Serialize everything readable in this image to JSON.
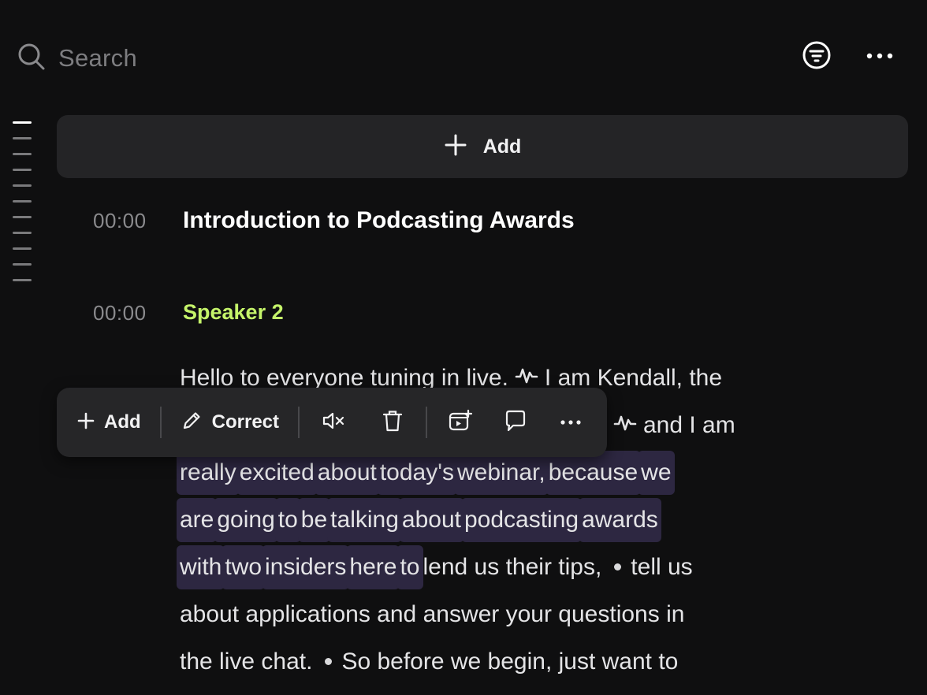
{
  "search": {
    "placeholder": "Search",
    "icon": "search-icon"
  },
  "header_actions": {
    "filter_icon": "filter-icon",
    "more_icon": "more-icon"
  },
  "add_section": {
    "label": "Add"
  },
  "chapter": {
    "timestamp": "00:00",
    "title": "Introduction to Podcasting Awards"
  },
  "paragraph": {
    "timestamp": "00:00",
    "speaker": "Speaker 2"
  },
  "transcript": {
    "line1_a": "Hello to everyone tuning in live.",
    "line1_b": "I am Kendall, the",
    "line2_tail": "and I am",
    "line3": [
      "really",
      "excited",
      "about",
      "today's",
      "webinar,",
      "because",
      "we"
    ],
    "line4": [
      "are",
      "going",
      "to",
      "be",
      "talking",
      "about",
      "podcasting",
      "awards"
    ],
    "line5_hl": [
      "with",
      "two",
      "insiders",
      "here",
      "to"
    ],
    "line5_tail_a": "lend us their tips,",
    "line5_tail_b": "tell us",
    "line6": "about applications and answer your questions in",
    "line7_a": "the live chat.",
    "line7_b": "So before we begin, just want to"
  },
  "toolbar": {
    "add_label": "Add",
    "correct_label": "Correct"
  },
  "colors": {
    "speaker": "#c5f46a",
    "highlight": "#2d2741",
    "background": "#0f0f10",
    "panel": "#242426"
  }
}
